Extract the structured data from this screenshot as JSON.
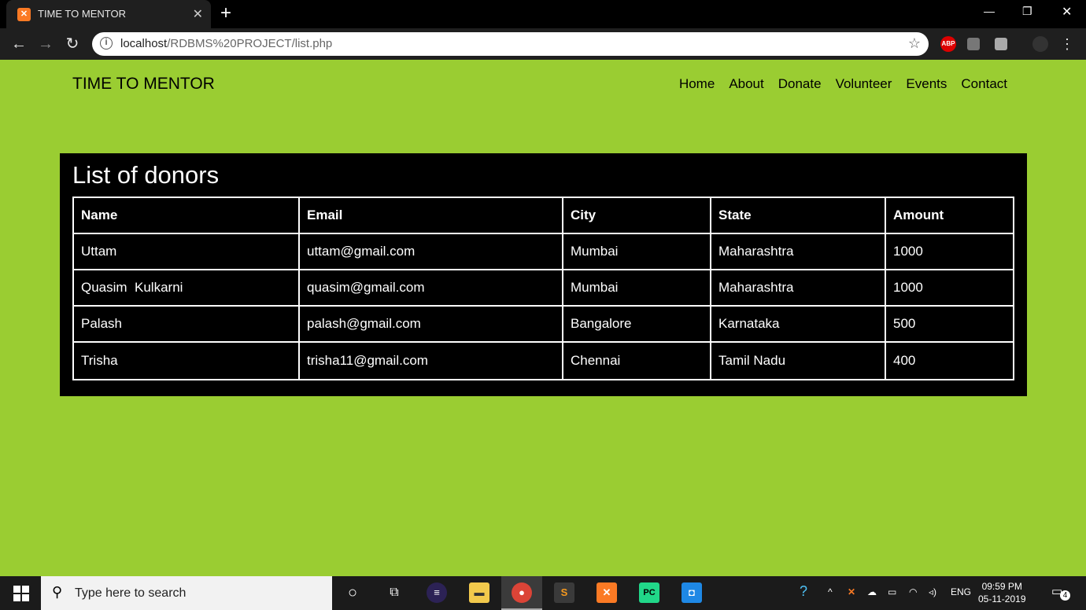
{
  "browser": {
    "tab_title": "TIME TO MENTOR",
    "url_host": "localhost",
    "url_path": "/RDBMS%20PROJECT/list.php",
    "extensions": [
      "ABP"
    ]
  },
  "site": {
    "brand": "TIME TO MENTOR",
    "nav": [
      "Home",
      "About",
      "Donate",
      "Volunteer",
      "Events",
      "Contact"
    ]
  },
  "donors": {
    "heading": "List of donors",
    "columns": [
      "Name",
      "Email",
      "City",
      "State",
      "Amount"
    ],
    "rows": [
      [
        "Uttam",
        "uttam@gmail.com",
        "Mumbai",
        "Maharashtra",
        "1000"
      ],
      [
        "Quasim  Kulkarni",
        "quasim@gmail.com",
        "Mumbai",
        "Maharashtra",
        "1000"
      ],
      [
        "Palash",
        "palash@gmail.com",
        "Bangalore",
        "Karnataka",
        "500"
      ],
      [
        "Trisha",
        "trisha11@gmail.com",
        "Chennai",
        "Tamil Nadu",
        "400"
      ]
    ]
  },
  "taskbar": {
    "search_placeholder": "Type here to search",
    "language": "ENG",
    "time": "09:59 PM",
    "date": "05-11-2019",
    "notification_count": "4",
    "pinned_icons": [
      "cortana-icon",
      "task-view-icon",
      "eclipse-icon",
      "file-explorer-icon",
      "chrome-icon",
      "sublime-text-icon",
      "xampp-icon",
      "pycharm-icon",
      "app-icon"
    ]
  },
  "colors": {
    "page_background": "#9acd32",
    "panel_background": "#000000",
    "table_border": "#ffffff"
  }
}
